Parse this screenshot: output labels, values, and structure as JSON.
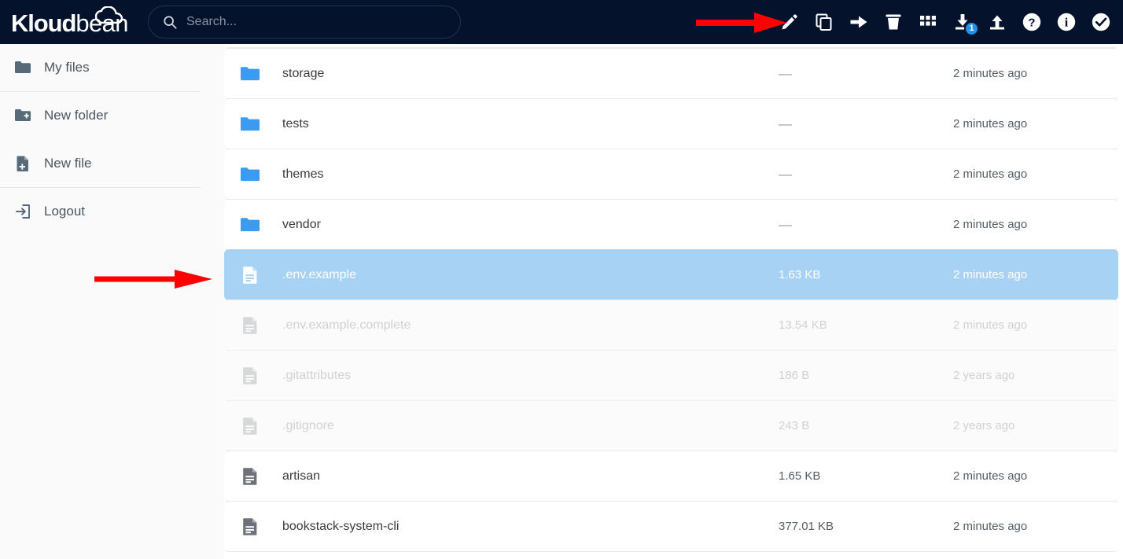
{
  "app": {
    "brand_primary": "Kloud",
    "brand_secondary": "bean",
    "header_bg": "#04122b",
    "accent_blue": "#1f92e8",
    "folder_blue": "#3b9bf0",
    "selected_row_bg": "#a7d2f4"
  },
  "search": {
    "placeholder": "Search...",
    "value": ""
  },
  "toolbar": {
    "items": [
      {
        "name": "edit-icon",
        "label": "Edit",
        "badge": null
      },
      {
        "name": "copy-icon",
        "label": "Copy",
        "badge": null
      },
      {
        "name": "arrow-right-icon",
        "label": "Move",
        "badge": null
      },
      {
        "name": "trash-icon",
        "label": "Delete",
        "badge": null
      },
      {
        "name": "grid-icon",
        "label": "Grid view",
        "badge": null
      },
      {
        "name": "download-icon",
        "label": "Download",
        "badge": "1"
      },
      {
        "name": "upload-icon",
        "label": "Upload",
        "badge": null
      },
      {
        "name": "help-icon",
        "label": "Help",
        "badge": null
      },
      {
        "name": "info-icon",
        "label": "Info",
        "badge": null
      },
      {
        "name": "check-circle-icon",
        "label": "Select all",
        "badge": null
      }
    ],
    "download_badge": "1"
  },
  "sidebar": {
    "items": [
      {
        "label": "My files",
        "icon": "folder-icon"
      },
      {
        "label": "New folder",
        "icon": "folder-plus-icon"
      },
      {
        "label": "New file",
        "icon": "file-plus-icon"
      },
      {
        "label": "Logout",
        "icon": "logout-icon"
      }
    ]
  },
  "filelist": {
    "rows": [
      {
        "name": "storage",
        "type": "folder",
        "size": "—",
        "date": "2 minutes ago",
        "state": "normal"
      },
      {
        "name": "tests",
        "type": "folder",
        "size": "—",
        "date": "2 minutes ago",
        "state": "normal"
      },
      {
        "name": "themes",
        "type": "folder",
        "size": "—",
        "date": "2 minutes ago",
        "state": "normal"
      },
      {
        "name": "vendor",
        "type": "folder",
        "size": "—",
        "date": "2 minutes ago",
        "state": "normal"
      },
      {
        "name": ".env.example",
        "type": "file",
        "size": "1.63 KB",
        "date": "2 minutes ago",
        "state": "selected"
      },
      {
        "name": ".env.example.complete",
        "type": "file",
        "size": "13.54 KB",
        "date": "2 minutes ago",
        "state": "dimmed"
      },
      {
        "name": ".gitattributes",
        "type": "file",
        "size": "186 B",
        "date": "2 years ago",
        "state": "dimmed"
      },
      {
        "name": ".gitignore",
        "type": "file",
        "size": "243 B",
        "date": "2 years ago",
        "state": "dimmed"
      },
      {
        "name": "artisan",
        "type": "file",
        "size": "1.65 KB",
        "date": "2 minutes ago",
        "state": "normal"
      },
      {
        "name": "bookstack-system-cli",
        "type": "file",
        "size": "377.01 KB",
        "date": "2 minutes ago",
        "state": "normal"
      }
    ]
  },
  "annotations": {
    "arrows": [
      {
        "name": "arrow-pointing-to-edit-icon",
        "direction": "right",
        "color": "#ff0000"
      },
      {
        "name": "arrow-pointing-to-selected-file-row",
        "direction": "right",
        "color": "#ff0000"
      }
    ]
  }
}
